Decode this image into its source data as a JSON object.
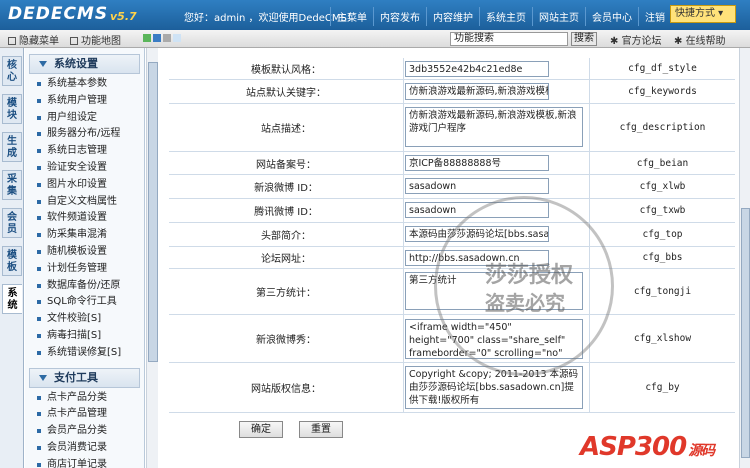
{
  "header": {
    "logo": "DEDECMS",
    "version": "v5.7",
    "welcome": "您好：admin ，欢迎使用DedeCMS！",
    "nav": [
      "主菜单",
      "内容发布",
      "内容维护",
      "系统主页",
      "网站主页",
      "会员中心",
      "注销"
    ],
    "quick_menu": "快捷方式 ▾"
  },
  "subbar": {
    "hide_menu": "隐藏菜单",
    "sitemap": "功能地图",
    "search_placeholder": "功能搜索",
    "search_button": "搜索",
    "forum": "官方论坛",
    "help": "在线帮助"
  },
  "vtabs": [
    "核心",
    "模块",
    "生成",
    "采集",
    "会员",
    "模板",
    "系统"
  ],
  "sidebar": {
    "groups": [
      {
        "title": "系统设置",
        "items": [
          "系统基本参数",
          "系统用户管理",
          "用户组设定",
          "服务器分布/远程",
          "系统日志管理",
          "验证安全设置",
          "图片水印设置",
          "自定义文档属性",
          "软件频道设置",
          "防采集串混淆",
          "随机模板设置",
          "计划任务管理",
          "数据库备份/还原",
          "SQL命令行工具",
          "文件校验[S]",
          "病毒扫描[S]",
          "系统错误修复[S]"
        ]
      },
      {
        "title": "支付工具",
        "items": [
          "点卡产品分类",
          "点卡产品管理",
          "会员产品分类",
          "会员消费记录",
          "商店订单记录"
        ]
      }
    ]
  },
  "settings": [
    {
      "label": "模板默认风格：",
      "value": "3db3552e42b4c21ed8e",
      "key": "cfg_df_style"
    },
    {
      "label": "站点默认关键字：",
      "value": "仿新浪游戏最新源码,新浪游戏模板",
      "key": "cfg_keywords"
    },
    {
      "label": "站点描述：",
      "value": "仿新浪游戏最新源码,新浪游戏模板,新浪游戏门户程序",
      "key": "cfg_description"
    },
    {
      "label": "网站备案号：",
      "value": "京ICP备88888888号",
      "key": "cfg_beian"
    },
    {
      "label": "新浪微博 ID：",
      "value": "sasadown",
      "key": "cfg_xlwb"
    },
    {
      "label": "腾讯微博 ID：",
      "value": "sasadown",
      "key": "cfg_txwb"
    },
    {
      "label": "头部简介：",
      "value": "本源码由莎莎源码论坛[bbs.sasadown",
      "key": "cfg_top"
    },
    {
      "label": "论坛网址：",
      "value": "http://bbs.sasadown.cn",
      "key": "cfg_bbs"
    },
    {
      "label": "第三方统计：",
      "value": "第三方统计",
      "key": "cfg_tongji"
    },
    {
      "label": "新浪微博秀：",
      "value": "<iframe width=\"450\" height=\"700\" class=\"share_self\"  frameborder=\"0\" scrolling=\"no\" src=\"http://widget",
      "key": "cfg_xlshow"
    },
    {
      "label": "网站版权信息：",
      "value": "Copyright &copy; 2011-2013 本源码由莎莎源码论坛[bbs.sasadown.cn]提供下载!版权所有",
      "key": "cfg_by"
    }
  ],
  "buttons": {
    "ok": "确定",
    "reset": "重置"
  },
  "watermark": {
    "line1": "莎莎授权",
    "line2": "盗卖必究"
  },
  "brand_logo": {
    "text": "ASP300",
    "suffix": "源码"
  },
  "colors": {
    "topbar": "#2f7fc2",
    "accent": "#ffd24a",
    "row_border": "#cfdbe8"
  }
}
